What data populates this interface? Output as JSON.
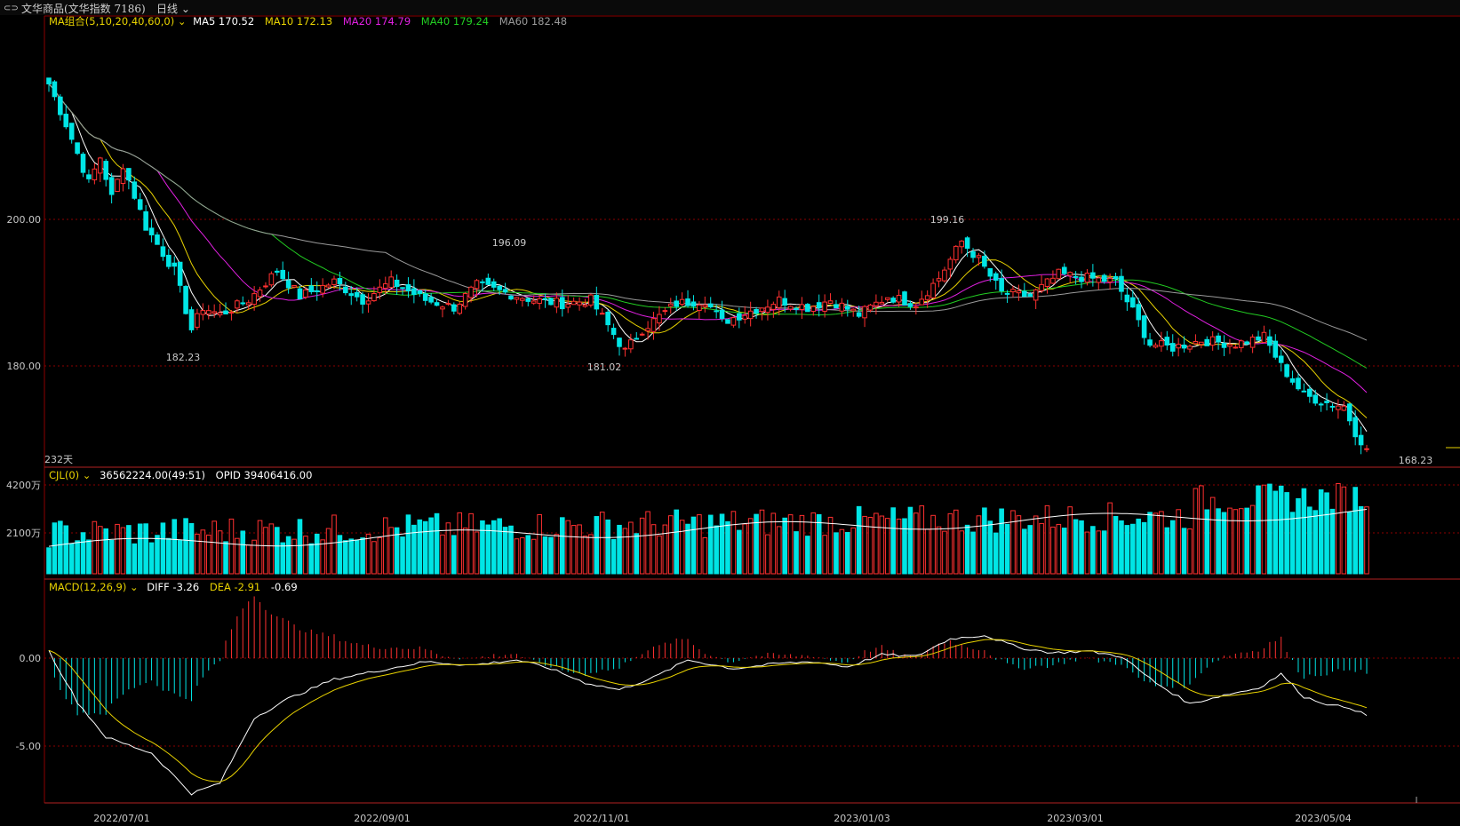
{
  "header": {
    "title": "文华商品(文华指数 7186)",
    "period": "日线"
  },
  "legends": {
    "ma": {
      "name": "MA组合(5,10,20,40,60,0)",
      "items": [
        {
          "label": "MA5 170.52",
          "color": "#ffffff"
        },
        {
          "label": "MA10 172.13",
          "color": "#e8d200"
        },
        {
          "label": "MA20 174.79",
          "color": "#e020e0"
        },
        {
          "label": "MA40 179.24",
          "color": "#22cc22"
        },
        {
          "label": "MA60 182.48",
          "color": "#9a9a9a"
        }
      ]
    },
    "volume": {
      "name": "CJL(0)",
      "values": "36562224.00(49:51)",
      "opid": "OPID 39406416.00"
    },
    "macd": {
      "name": "MACD(12,26,9)",
      "diff": "DIFF -3.26",
      "dea": "DEA -2.91",
      "macd": "-0.69"
    }
  },
  "price_panel": {
    "y_ticks": [
      "200.00",
      "180.00"
    ],
    "annotations": [
      {
        "label": "182.23",
        "color": "#00e5e5"
      },
      {
        "label": "196.09",
        "color": "#ff3030"
      },
      {
        "label": "181.02",
        "color": "#00e5e5"
      },
      {
        "label": "199.16",
        "color": "#ff3030"
      },
      {
        "label": "168.23",
        "color": "#00e5e5"
      }
    ],
    "days_label": "232天"
  },
  "volume_panel": {
    "y_ticks": [
      "4200万",
      "2100万"
    ]
  },
  "macd_panel": {
    "y_ticks": [
      "0.00",
      "-5.00"
    ]
  },
  "x_axis": {
    "ticks": [
      "2022/07/01",
      "2022/09/01",
      "2022/11/01",
      "2023/01/03",
      "2023/03/01",
      "2023/05/04"
    ]
  },
  "colors": {
    "up": "#ff3030",
    "down": "#00e5e5",
    "grid": "#8b0000"
  },
  "chart_data": {
    "type": "candlestick",
    "count": 232,
    "close_anchors": [
      {
        "i": 0,
        "v": 218.5
      },
      {
        "i": 3,
        "v": 213
      },
      {
        "i": 7,
        "v": 205
      },
      {
        "i": 9,
        "v": 208.5
      },
      {
        "i": 11,
        "v": 203
      },
      {
        "i": 13,
        "v": 207.5
      },
      {
        "i": 17,
        "v": 199
      },
      {
        "i": 22,
        "v": 193
      },
      {
        "i": 25,
        "v": 185
      },
      {
        "i": 27,
        "v": 188
      },
      {
        "i": 30,
        "v": 187
      },
      {
        "i": 35,
        "v": 189
      },
      {
        "i": 40,
        "v": 193
      },
      {
        "i": 44,
        "v": 189.5
      },
      {
        "i": 50,
        "v": 191.5
      },
      {
        "i": 55,
        "v": 189
      },
      {
        "i": 60,
        "v": 191.5
      },
      {
        "i": 66,
        "v": 189
      },
      {
        "i": 71,
        "v": 188
      },
      {
        "i": 75,
        "v": 191
      },
      {
        "i": 80,
        "v": 190
      },
      {
        "i": 85,
        "v": 189
      },
      {
        "i": 90,
        "v": 188.5
      },
      {
        "i": 95,
        "v": 189
      },
      {
        "i": 98,
        "v": 185.5
      },
      {
        "i": 101,
        "v": 182
      },
      {
        "i": 104,
        "v": 185
      },
      {
        "i": 110,
        "v": 188.5
      },
      {
        "i": 115,
        "v": 189
      },
      {
        "i": 118,
        "v": 186
      },
      {
        "i": 123,
        "v": 187.5
      },
      {
        "i": 128,
        "v": 189
      },
      {
        "i": 133,
        "v": 188
      },
      {
        "i": 137,
        "v": 189
      },
      {
        "i": 142,
        "v": 187
      },
      {
        "i": 147,
        "v": 189.5
      },
      {
        "i": 152,
        "v": 188.5
      },
      {
        "i": 156,
        "v": 192
      },
      {
        "i": 160,
        "v": 197
      },
      {
        "i": 163,
        "v": 194.5
      },
      {
        "i": 167,
        "v": 190
      },
      {
        "i": 172,
        "v": 189.5
      },
      {
        "i": 177,
        "v": 192.5
      },
      {
        "i": 182,
        "v": 192
      },
      {
        "i": 187,
        "v": 191.5
      },
      {
        "i": 190,
        "v": 187.5
      },
      {
        "i": 193,
        "v": 183
      },
      {
        "i": 197,
        "v": 182.5
      },
      {
        "i": 202,
        "v": 183.5
      },
      {
        "i": 208,
        "v": 183
      },
      {
        "i": 213,
        "v": 184
      },
      {
        "i": 216,
        "v": 180
      },
      {
        "i": 220,
        "v": 176
      },
      {
        "i": 224,
        "v": 175
      },
      {
        "i": 227,
        "v": 174.5
      },
      {
        "i": 229,
        "v": 171
      },
      {
        "i": 231,
        "v": 168.7
      }
    ],
    "low_point": 168.23,
    "macd_anchors": [
      {
        "i": 0,
        "v": 0.4
      },
      {
        "i": 5,
        "v": -2.5
      },
      {
        "i": 10,
        "v": -4.5
      },
      {
        "i": 18,
        "v": -5.4
      },
      {
        "i": 25,
        "v": -7.7
      },
      {
        "i": 30,
        "v": -7.1
      },
      {
        "i": 36,
        "v": -3.4
      },
      {
        "i": 42,
        "v": -2.3
      },
      {
        "i": 50,
        "v": -1.2
      },
      {
        "i": 58,
        "v": -0.7
      },
      {
        "i": 66,
        "v": -0.2
      },
      {
        "i": 74,
        "v": -0.4
      },
      {
        "i": 82,
        "v": -0.1
      },
      {
        "i": 88,
        "v": -0.6
      },
      {
        "i": 94,
        "v": -1.4
      },
      {
        "i": 100,
        "v": -1.8
      },
      {
        "i": 106,
        "v": -1.1
      },
      {
        "i": 112,
        "v": -0.1
      },
      {
        "i": 120,
        "v": -0.6
      },
      {
        "i": 128,
        "v": -0.3
      },
      {
        "i": 134,
        "v": -0.2
      },
      {
        "i": 140,
        "v": -0.5
      },
      {
        "i": 146,
        "v": 0.2
      },
      {
        "i": 152,
        "v": 0.1
      },
      {
        "i": 158,
        "v": 1.1
      },
      {
        "i": 164,
        "v": 1.3
      },
      {
        "i": 170,
        "v": 0.6
      },
      {
        "i": 176,
        "v": 0.3
      },
      {
        "i": 182,
        "v": 0.4
      },
      {
        "i": 188,
        "v": 0.1
      },
      {
        "i": 194,
        "v": -1.4
      },
      {
        "i": 200,
        "v": -2.6
      },
      {
        "i": 206,
        "v": -2.1
      },
      {
        "i": 212,
        "v": -1.7
      },
      {
        "i": 216,
        "v": -0.9
      },
      {
        "i": 220,
        "v": -2.2
      },
      {
        "i": 225,
        "v": -2.7
      },
      {
        "i": 228,
        "v": -2.8
      },
      {
        "i": 231,
        "v": -3.26
      }
    ]
  }
}
